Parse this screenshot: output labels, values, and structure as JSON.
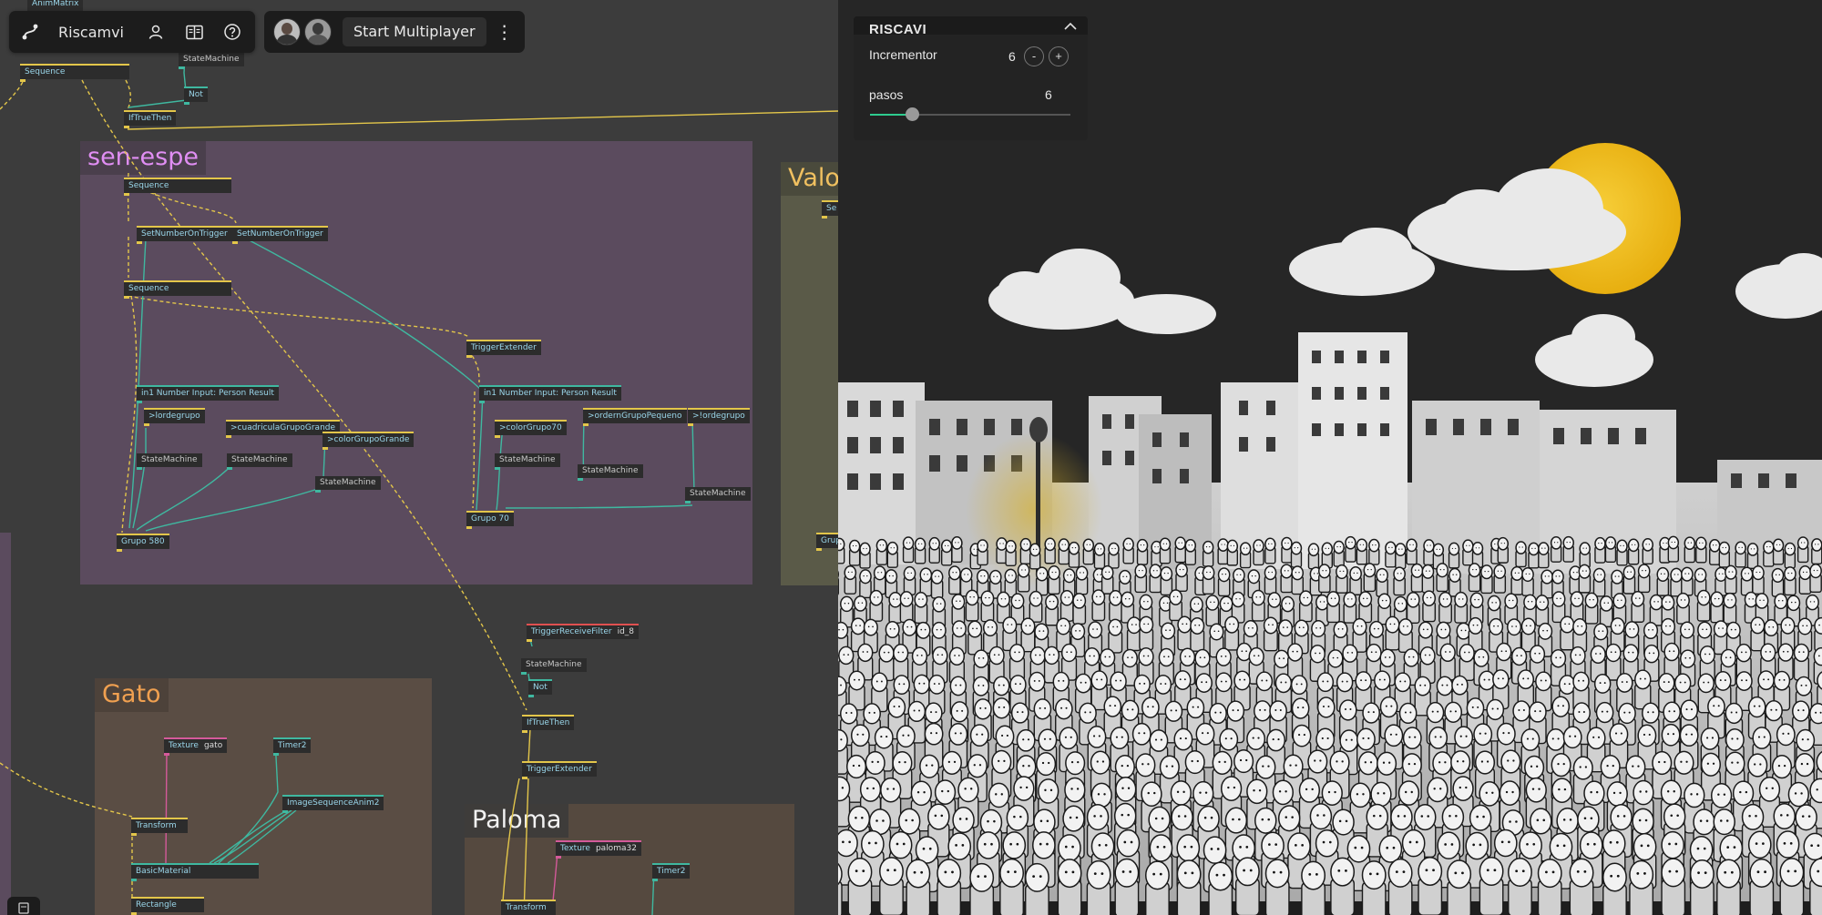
{
  "app": {
    "title": "Riscamvi",
    "multiplayer_label": "Start Multiplayer",
    "icons": [
      "logo-icon",
      "user-icon",
      "book-icon",
      "help-icon",
      "kebab-icon",
      "save-icon"
    ]
  },
  "groups": {
    "sen_espe": "sen-espe",
    "valo": "Valo",
    "gato": "Gato",
    "paloma": "Paloma"
  },
  "nodes": {
    "anim_matrix": "AnimMatrix",
    "state_machine_top": "StateMachine",
    "sequence_top": "Sequence",
    "not_top": "Not",
    "if_true_then_top": "IfTrueThen",
    "sequence_1": "Sequence",
    "set_number_1": "SetNumberOnTrigger",
    "set_number_2": "SetNumberOnTrigger",
    "sequence_2": "Sequence",
    "trigger_extender_1": "TriggerExtender",
    "number_input_1": "in1 Number Input: Person Result",
    "number_input_2": "in1 Number Input: Person Result",
    "lordegrupo_1": ">lordegrupo",
    "cuadricula": ">cuadriculaGrupoGrande",
    "color_grande": ">colorGrupoGrande",
    "color_70": ">colorGrupo70",
    "orden_pequeno": ">ordernGrupoPequeno",
    "lordegrupo_2": ">!ordegrupo",
    "sm_1": "StateMachine",
    "sm_2": "StateMachine",
    "sm_3": "StateMachine",
    "sm_4": "StateMachine",
    "sm_5": "StateMachine",
    "sm_6": "StateMachine",
    "grupo_580": "Grupo 580",
    "grupo_70": "Grupo 70",
    "trigger_receive": "TriggerReceiveFilter",
    "trigger_receive_arg": "id_8",
    "sm_7": "StateMachine",
    "not_2": "Not",
    "if_true_then_2": "IfTrueThen",
    "trigger_extender_2": "TriggerExtender",
    "texture_gato": "Texture",
    "texture_gato_arg": "gato",
    "timer_1": "Timer2",
    "image_seq": "ImageSequenceAnim2",
    "transform_1": "Transform",
    "basic_material": "BasicMaterial",
    "rectangle": "Rectangle",
    "texture_paloma": "Texture",
    "texture_paloma_arg": "paloma32",
    "timer_2": "Timer2",
    "transform_2": "Transform",
    "valo_node": "Se",
    "valo_grupo": "Grup"
  },
  "panel": {
    "title": "RISCAVI",
    "incrementor_label": "Incrementor",
    "incrementor_value": "6",
    "minus_label": "-",
    "plus_label": "+",
    "pasos_label": "pasos",
    "pasos_value": "6",
    "pasos_fraction": 0.21
  },
  "colors": {
    "editor_bg": "#3c3c3c",
    "wire_trigger": "#e3c64a",
    "wire_number": "#3fb8a0",
    "wire_texture": "#d45a9a",
    "slider_accent": "#2ecc8f",
    "group_sen_espe": "#5b4b5e",
    "group_valo": "#5a5a48",
    "group_gato": "#5a4d44",
    "moon": "#f2be18"
  }
}
